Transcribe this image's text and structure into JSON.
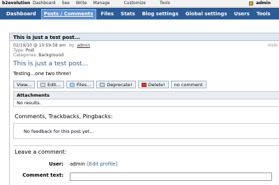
{
  "topbar": {
    "brand": "b2evolution",
    "menus": [
      "Dashboard",
      "See",
      "Write",
      "Manage",
      "Customize",
      "Tools"
    ],
    "user": "admin"
  },
  "nav": {
    "tabs": [
      "Dashboard",
      "Posts / Comments",
      "Files",
      "Stats",
      "Blog settings",
      "Global settings",
      "Users",
      "Tools"
    ],
    "active_index": 1
  },
  "panel": {
    "title": "This is just a test post...",
    "post": {
      "date": "02/19/10 @ 10:59:58 am",
      "by": "by",
      "author": "admin",
      "type_label": "Type:",
      "type_value": "Post",
      "categories_label": "Categories:",
      "categories_value": "Background",
      "visibility": "Visib",
      "title": "This is just a test post...",
      "content": "Testing...one two three!"
    },
    "actions": {
      "view": "View...",
      "edit": "Edit...",
      "files": "Files...",
      "deprecate": "Deprecate!",
      "delete": "Delete!",
      "no_comment": "no comment"
    },
    "attachments": {
      "title": "Attachments",
      "body": "No results."
    },
    "feedback": {
      "heading": "Comments, Trackbacks, Pingbacks:",
      "empty": "No feedback for this post yet..."
    },
    "leave_comment": {
      "heading": "Leave a comment:",
      "user_label": "User:",
      "user_value": "admin",
      "edit_profile": "[Edit profile]",
      "comment_label": "Comment text:"
    }
  }
}
